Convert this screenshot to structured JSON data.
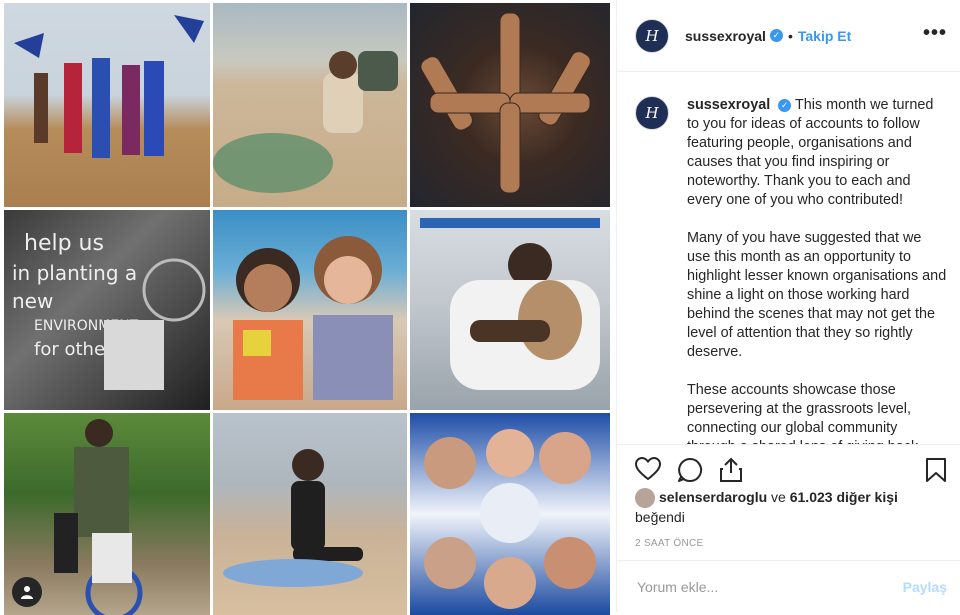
{
  "post": {
    "username": "sussexroyal",
    "follow_label": "Takip Et",
    "dot": "•",
    "more_label": "•••",
    "avatar_letter": "H",
    "verified_mark": "✓",
    "caption_paragraphs": [
      "This month we turned to you for ideas of accounts to follow featuring people, organisations and causes that you find inspiring or noteworthy. Thank you to each and every one of you who contributed!",
      "Many of you have suggested that we use this month as an opportunity to highlight lesser known organisations and shine a light on those working hard behind the scenes that may not get the level of attention that they so rightly deserve.",
      "These accounts showcase those persevering at the grassroots level, connecting our global community through a shared lens of giving back."
    ],
    "likes": {
      "liker": "selenserdaroglu",
      "connector": "ve",
      "count_text": "61.023 diğer kişi",
      "suffix": "beğendi"
    },
    "timestamp": "2 SAAT ÖNCE",
    "comment_placeholder": "Yorum ekle...",
    "share_label": "Paylaş"
  },
  "grid_tiles": [
    {
      "subject": "dancers-with-flags"
    },
    {
      "subject": "person-collecting-beach-plastic"
    },
    {
      "subject": "stacked-hands"
    },
    {
      "subject": "help-us-in-planting-a-new-environment-mural"
    },
    {
      "subject": "two-smiling-children"
    },
    {
      "subject": "man-hugging-dog"
    },
    {
      "subject": "man-with-child-in-wheelchair"
    },
    {
      "subject": "child-surfer-on-beach"
    },
    {
      "subject": "group-selfie-circle"
    }
  ],
  "colors": {
    "accent": "#3897f0",
    "text": "#262626",
    "muted": "#999999",
    "divider": "#efefef",
    "share_disabled": "#b3dbff"
  },
  "icons": [
    "heart-icon",
    "comment-icon",
    "share-icon",
    "bookmark-icon",
    "user-tag-icon",
    "verified-icon",
    "more-icon"
  ]
}
